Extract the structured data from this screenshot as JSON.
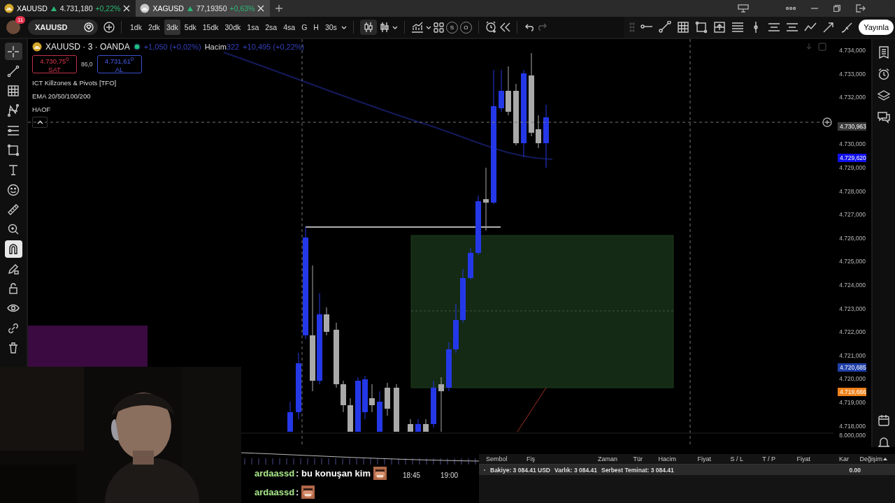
{
  "tabs": [
    {
      "symbol": "XAUUSD",
      "price": "4.731,180",
      "change": "+0,22%",
      "selected": true
    },
    {
      "symbol": "XAGUSD",
      "price": "77,19350",
      "change": "+0,63%",
      "selected": false
    }
  ],
  "toolbar": {
    "notification_count": "11",
    "symbol": "XAUUSD",
    "intervals": [
      {
        "label": "1dk",
        "selected": false
      },
      {
        "label": "2dk",
        "selected": false
      },
      {
        "label": "3dk",
        "selected": true
      },
      {
        "label": "5dk",
        "selected": false
      },
      {
        "label": "15dk",
        "selected": false
      },
      {
        "label": "30dk",
        "selected": false
      },
      {
        "label": "1sa",
        "selected": false
      },
      {
        "label": "2sa",
        "selected": false
      },
      {
        "label": "4sa",
        "selected": false
      },
      {
        "label": "G",
        "selected": false
      },
      {
        "label": "H",
        "selected": false
      },
      {
        "label": "30s",
        "selected": false
      }
    ],
    "circle_buttons": [
      "S",
      "O"
    ],
    "publish": "Yayınla"
  },
  "left_tools": [
    {
      "kind": "crosshair",
      "selected": true
    },
    {
      "kind": "line",
      "selected": false
    },
    {
      "kind": "grid",
      "selected": false
    },
    {
      "kind": "pattern",
      "selected": false
    },
    {
      "kind": "levels",
      "selected": false
    },
    {
      "kind": "rectangle",
      "selected": false
    },
    {
      "kind": "text",
      "selected": false
    },
    {
      "kind": "smiley",
      "selected": false
    },
    {
      "kind": "ruler",
      "selected": false
    },
    {
      "kind": "zoom",
      "selected": false
    },
    {
      "kind": "magnet",
      "selected": true
    },
    {
      "kind": "pencil",
      "selected": false
    },
    {
      "kind": "lock",
      "selected": false
    },
    {
      "kind": "eye",
      "selected": false
    },
    {
      "kind": "link",
      "selected": false
    },
    {
      "kind": "trash",
      "selected": false
    }
  ],
  "legend": {
    "title": "XAUUSD · 3 · OANDA",
    "change": "+1,050 (+0,02%)",
    "volume_label": "Hacim",
    "volume": "322",
    "volume_change": "+10,495 (+0,22%)",
    "sell": {
      "price": "4.730,75$^{0}$",
      "label": "SAT"
    },
    "spread": "86,0",
    "buy": {
      "price": "4.731,61$^{0}$",
      "label": "AL"
    },
    "indicators": [
      "ICT Killzones & Pivots [TFO]",
      "EMA 20/50/100/200",
      "HAOF"
    ]
  },
  "price_axis": {
    "ticks": [
      "4.734,000",
      "4.733,000",
      "4.732,000",
      "4.730,000",
      "4.729,000",
      "4.728,000",
      "4.727,000",
      "4.726,000",
      "4.725,000",
      "4.724,000",
      "4.723,000",
      "4.722,000",
      "4.721,000",
      "4.720,000",
      "4.719,000",
      "4.718,000",
      "8.000,000"
    ],
    "badges": [
      {
        "text": "4.730,963",
        "color": "#3a3a3a"
      },
      {
        "text": "4.729,620",
        "color": "#1010e8"
      },
      {
        "text": "4.720,685",
        "color": "#1f3fa8"
      },
      {
        "text": "4.719,666",
        "color": "#f0801a"
      }
    ]
  },
  "time_axis": [
    "18:45",
    "19:00"
  ],
  "chat": [
    {
      "user": "ardaassd",
      "message": ": bu konuşan kim"
    },
    {
      "user": "ardaassd",
      "message": ":"
    }
  ],
  "trade_panel": {
    "columns": [
      "Sembol",
      "Fiş",
      "Zaman",
      "Tür",
      "Hacim",
      "Fiyat",
      "S / L",
      "T / P",
      "Fiyat",
      "Kar",
      "Değişim"
    ],
    "summary": [
      "Bakiye: 3 084.41 USD",
      "Varlık: 3 084.41",
      "Serbest Teminat: 3 084.41"
    ],
    "profit": "0.00"
  }
}
